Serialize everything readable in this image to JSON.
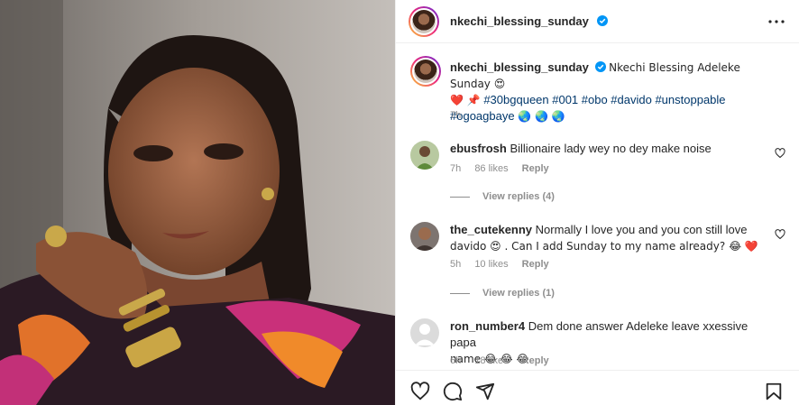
{
  "post": {
    "author": "nkechi_blessing_sunday",
    "caption_line1": "Nkechi Blessing Adeleke Sunday 😍",
    "caption_line2_emoji": "❤️ 📌",
    "hashtags_line2": "#30bgqueen #001 #obo #davido #unstoppable",
    "hashtags_line3": "#ogoagbaye",
    "globes": "🌏 🌏 🌏",
    "time": "7h"
  },
  "comments": [
    {
      "username": "ebusfrosh",
      "text": "Billionaire lady wey no dey make noise",
      "time": "7h",
      "likes": "86 likes",
      "reply": "Reply",
      "view_replies": "View replies (4)"
    },
    {
      "username": "the_cutekenny",
      "text_line1": "Normally I love you and you con still love",
      "text_line2": "davido 😍 . Can I add Sunday to my name already? 😂 ❤️",
      "time": "5h",
      "likes": "10 likes",
      "reply": "Reply",
      "view_replies": "View replies (1)"
    },
    {
      "username": "ron_number4",
      "text_line1": "Dem done answer Adeleke leave xxessive papa",
      "text_line2": "name 😂 😂 😂",
      "time": "6h",
      "likes": "18 likes",
      "reply": "Reply"
    }
  ],
  "icons": {
    "more": "more-options-icon",
    "verified": "verified-badge-icon",
    "like": "heart-icon",
    "comment": "comment-icon",
    "share": "share-icon",
    "save": "bookmark-icon"
  },
  "colors": {
    "verified": "#0095f6",
    "link": "#00376b",
    "muted": "#8e8e8e",
    "heart_red": "#ed4956"
  }
}
